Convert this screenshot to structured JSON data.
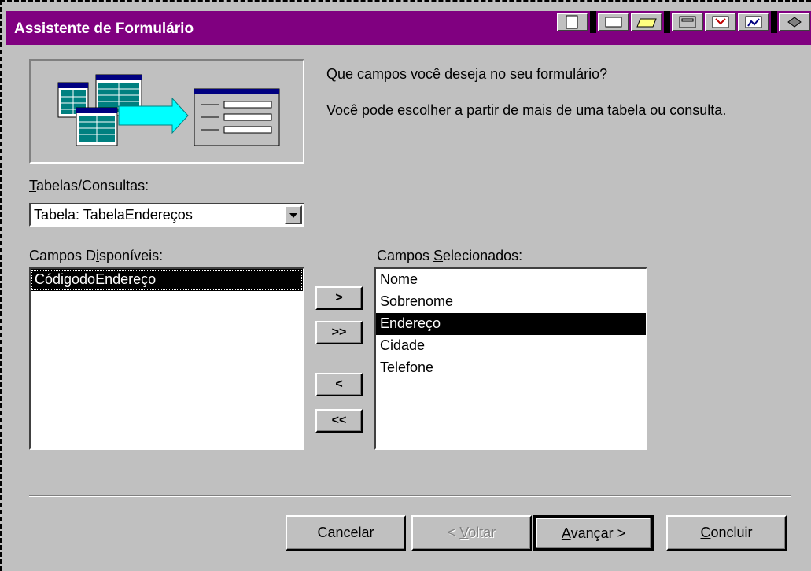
{
  "window": {
    "title": "Assistente de Formulário"
  },
  "wizard": {
    "question": "Que campos você deseja no seu formulário?",
    "description": "Você pode escolher a partir de mais de uma tabela ou consulta."
  },
  "tables": {
    "label_accel": "T",
    "label_rest": "abelas/Consultas:",
    "selected": "Tabela: TabelaEndereços"
  },
  "available": {
    "label_pre": "Campos D",
    "label_accel": "i",
    "label_post": "sponíveis:",
    "items": [
      "CódigodoEndereço"
    ]
  },
  "selected_fields": {
    "label_pre": "Campos ",
    "label_accel": "S",
    "label_post": "elecionados:",
    "items": [
      "Nome",
      "Sobrenome",
      "Endereço",
      "Cidade",
      "Telefone"
    ]
  },
  "move_buttons": {
    "add_one": ">",
    "add_all": ">>",
    "remove_one": "<",
    "remove_all": "<<"
  },
  "buttons": {
    "cancel": "Cancelar",
    "back_pre": "< ",
    "back_accel": "V",
    "back_post": "oltar",
    "next_accel": "A",
    "next_post": "vançar >",
    "finish_accel": "C",
    "finish_post": "oncluir"
  },
  "colors": {
    "titlebar": "#800080",
    "face": "#c0c0c0",
    "selection": "#000000"
  }
}
